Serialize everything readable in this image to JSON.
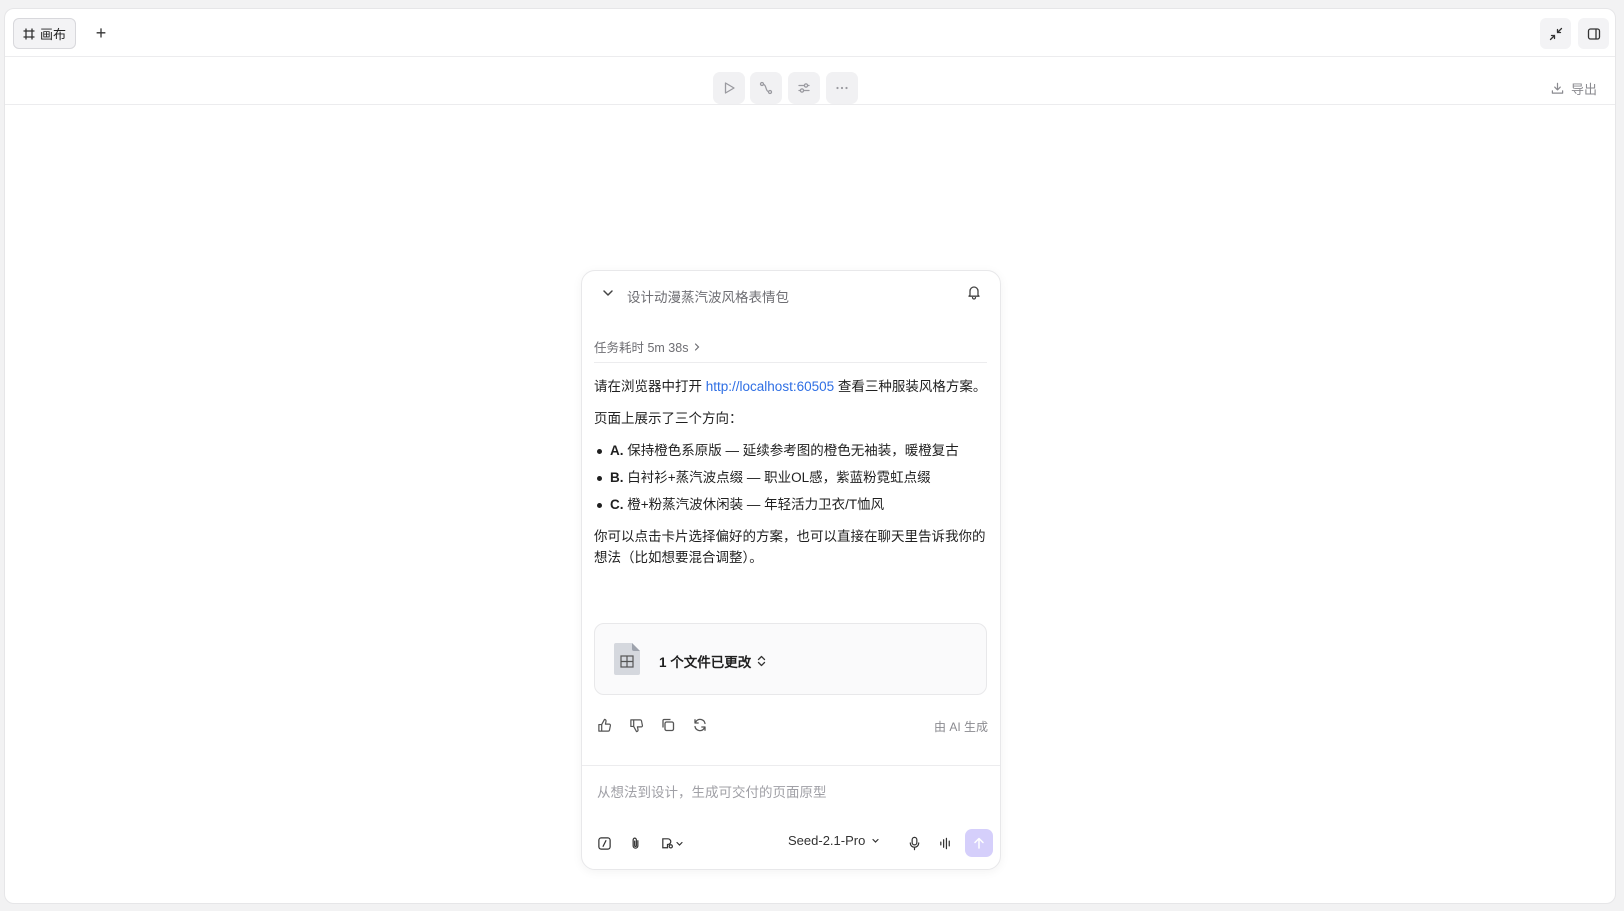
{
  "tabbar": {
    "tab_label": "画布",
    "add_label": "+"
  },
  "toolbar": {
    "export_label": "导出"
  },
  "panel": {
    "title": "设计动漫蒸汽波风格表情包",
    "duration": "任务耗时 5m 38s",
    "message": {
      "p1_prefix": "请在浏览器中打开 ",
      "link": "http://localhost:60505",
      "p1_suffix": " 查看三种服装风格方案。",
      "p2": "页面上展示了三个方向：",
      "options": [
        {
          "key": "A.",
          "text": " 保持橙色系原版 — 延续参考图的橙色无袖装，暖橙复古"
        },
        {
          "key": "B.",
          "text": " 白衬衫+蒸汽波点缀 — 职业OL感，紫蓝粉霓虹点缀"
        },
        {
          "key": "C.",
          "text": " 橙+粉蒸汽波休闲装 — 年轻活力卫衣/T恤风"
        }
      ],
      "p3": "你可以点击卡片选择偏好的方案，也可以直接在聊天里告诉我你的想法（比如想要混合调整）。"
    },
    "file_card_label": "1 个文件已更改",
    "ai_note": "由 AI 生成"
  },
  "input": {
    "placeholder": "从想法到设计，生成可交付的页面原型",
    "model": "Seed-2.1-Pro"
  },
  "colors": {
    "link": "#2f6fe4",
    "send_button": "#d5cffb"
  }
}
